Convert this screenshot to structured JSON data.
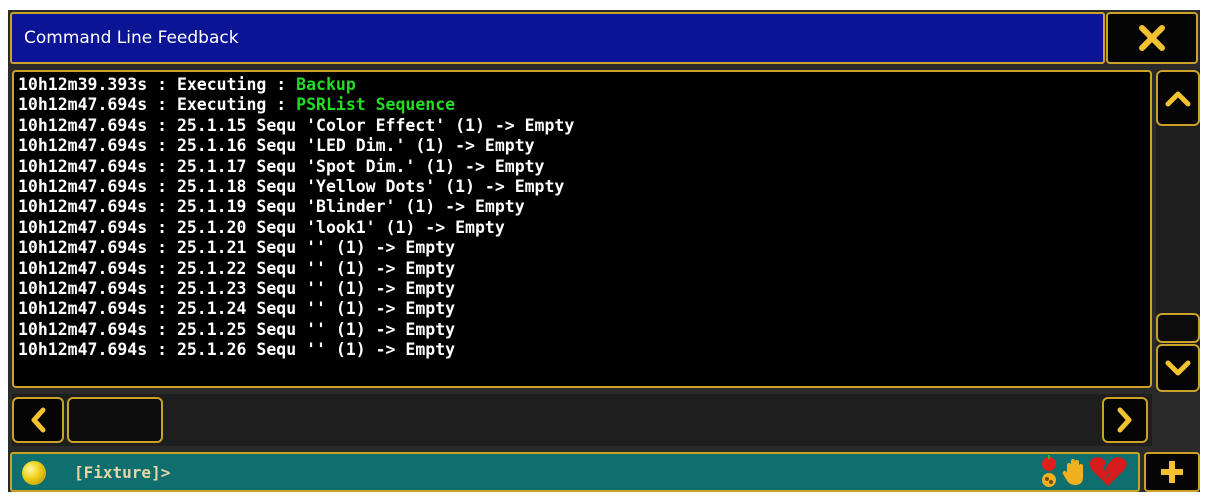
{
  "window": {
    "title": "Command Line Feedback"
  },
  "log": {
    "lines": [
      {
        "prefix": "10h12m39.393s : Executing : ",
        "highlight": "Backup"
      },
      {
        "prefix": "10h12m47.694s : Executing : ",
        "highlight": "PSRList Sequence"
      },
      {
        "prefix": "10h12m47.694s : 25.1.15 Sequ 'Color Effect' (1) -> Empty",
        "highlight": ""
      },
      {
        "prefix": "10h12m47.694s : 25.1.16 Sequ 'LED Dim.' (1) -> Empty",
        "highlight": ""
      },
      {
        "prefix": "10h12m47.694s : 25.1.17 Sequ 'Spot Dim.' (1) -> Empty",
        "highlight": ""
      },
      {
        "prefix": "10h12m47.694s : 25.1.18 Sequ 'Yellow Dots' (1) -> Empty",
        "highlight": ""
      },
      {
        "prefix": "10h12m47.694s : 25.1.19 Sequ 'Blinder' (1) -> Empty",
        "highlight": ""
      },
      {
        "prefix": "10h12m47.694s : 25.1.20 Sequ 'look1' (1) -> Empty",
        "highlight": ""
      },
      {
        "prefix": "10h12m47.694s : 25.1.21 Sequ '' (1) -> Empty",
        "highlight": ""
      },
      {
        "prefix": "10h12m47.694s : 25.1.22 Sequ '' (1) -> Empty",
        "highlight": ""
      },
      {
        "prefix": "10h12m47.694s : 25.1.23 Sequ '' (1) -> Empty",
        "highlight": ""
      },
      {
        "prefix": "10h12m47.694s : 25.1.24 Sequ '' (1) -> Empty",
        "highlight": ""
      },
      {
        "prefix": "10h12m47.694s : 25.1.25 Sequ '' (1) -> Empty",
        "highlight": ""
      },
      {
        "prefix": "10h12m47.694s : 25.1.26 Sequ '' (1) -> Empty",
        "highlight": ""
      }
    ]
  },
  "commandline": {
    "prompt": "[Fixture]>"
  },
  "icons": {
    "close": "close-icon",
    "scroll_up": "chevron-up-icon",
    "scroll_down": "chevron-down-icon",
    "scroll_left": "chevron-left-icon",
    "scroll_right": "chevron-right-icon",
    "status_ball": "status-ball-icon",
    "status_apple": "apple-icon",
    "status_hand": "hand-icon",
    "status_heart": "broken-heart-icon",
    "plus": "plus-icon"
  },
  "colors": {
    "accent": "#c9a227",
    "title_bg": "#0a1494",
    "command_bg": "#0f6e6e",
    "log_text": "#ffffff",
    "log_highlight": "#22dd22"
  }
}
